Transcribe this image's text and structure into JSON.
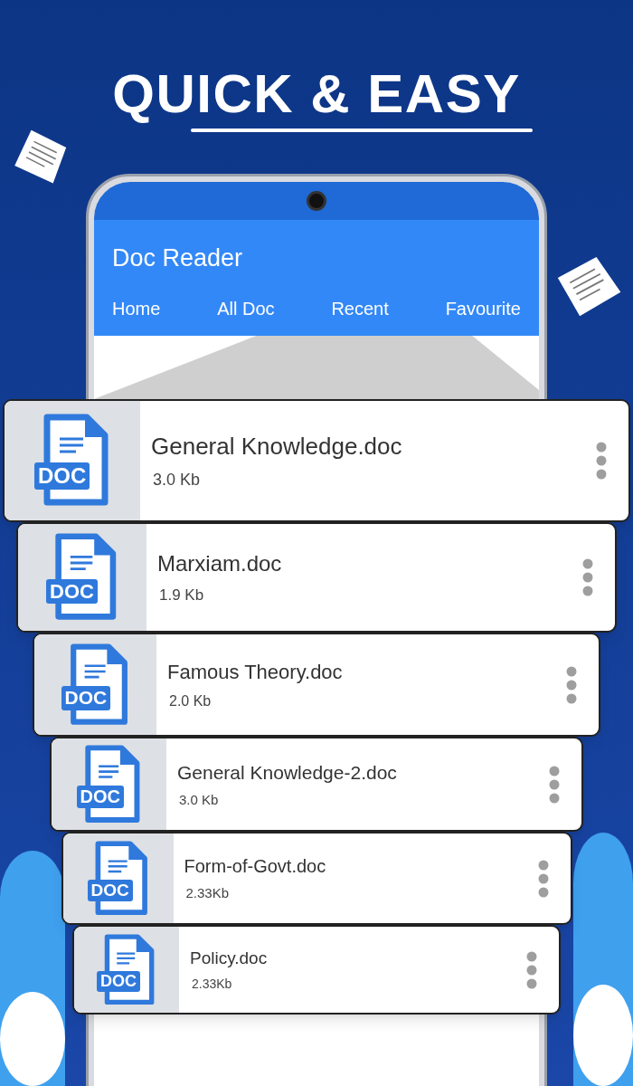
{
  "headline": "QUICK & EASY",
  "app": {
    "title": "Doc Reader",
    "tabs": [
      "Home",
      "All Doc",
      "Recent",
      "Favourite"
    ]
  },
  "files": [
    {
      "name": "General Knowledge.doc",
      "size": "3.0 Kb",
      "badge": "DOC"
    },
    {
      "name": "Marxiam.doc",
      "size": "1.9 Kb",
      "badge": "DOC"
    },
    {
      "name": "Famous Theory.doc",
      "size": "2.0 Kb",
      "badge": "DOC"
    },
    {
      "name": "General Knowledge-2.doc",
      "size": "3.0 Kb",
      "badge": "DOC"
    },
    {
      "name": "Form-of-Govt.doc",
      "size": "2.33Kb",
      "badge": "DOC"
    },
    {
      "name": "Policy.doc",
      "size": "2.33Kb",
      "badge": "DOC"
    }
  ]
}
